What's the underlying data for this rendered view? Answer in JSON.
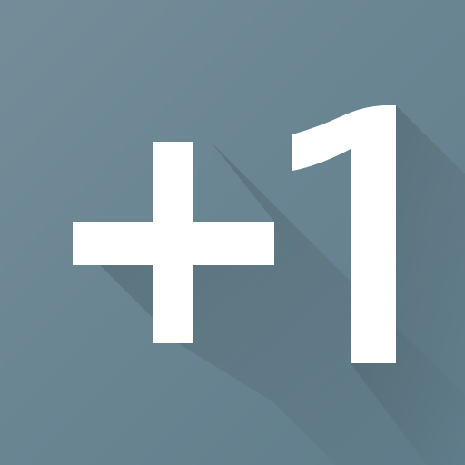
{
  "icon": {
    "name": "plus-one-icon",
    "glyph_text": "+1",
    "background_color": "#607d8b",
    "sheen_color": "#ffffff",
    "shadow_color": "#37474f",
    "glyph_color": "#ffffff"
  }
}
